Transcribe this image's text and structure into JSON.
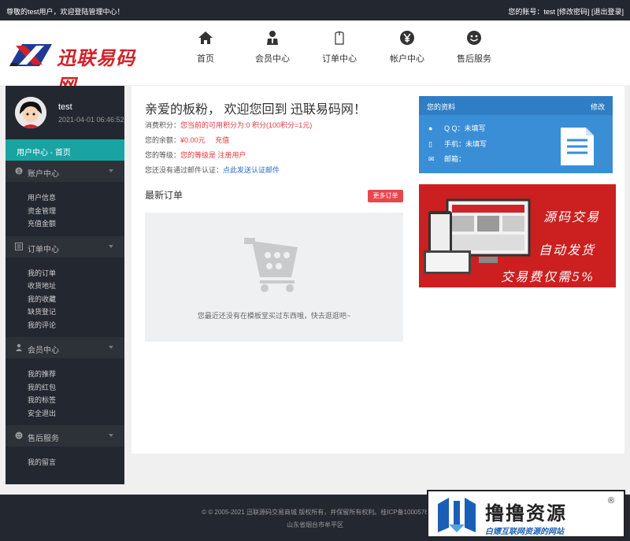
{
  "topbar": {
    "greeting": "尊敬的test用户，欢迎登陆管理中心！",
    "account": "您的账号：test",
    "change_pwd": "[修改密码]",
    "logout": "[退出登录]"
  },
  "brand": {
    "logo_text": "迅联易码网",
    "accent": "#d1222a"
  },
  "nav": [
    {
      "label": "首页",
      "icon": "home-icon"
    },
    {
      "label": "会员中心",
      "icon": "member-icon"
    },
    {
      "label": "订单中心",
      "icon": "order-icon"
    },
    {
      "label": "帐户中心",
      "icon": "yen-coin-icon"
    },
    {
      "label": "售后服务",
      "icon": "smile-icon"
    }
  ],
  "sidebar": {
    "username": "test",
    "login_time": "2021-04-01 06:46:52",
    "active": "用户中心 - 首页",
    "groups": [
      {
        "label": "账户中心",
        "icon": "dollar-circle-icon",
        "items": [
          "用户信息",
          "资金管理",
          "充值金额"
        ]
      },
      {
        "label": "订单中心",
        "icon": "list-icon",
        "items": [
          "我的订单",
          "收货地址",
          "我的收藏",
          "缺货登记",
          "我的评论"
        ]
      },
      {
        "label": "会员中心",
        "icon": "user-icon",
        "items": [
          "我的推荐",
          "我的红包",
          "我的标签",
          "安全退出"
        ]
      },
      {
        "label": "售后服务",
        "icon": "smile-icon",
        "items": [
          "我的留言"
        ]
      }
    ]
  },
  "main": {
    "welcome": "亲爱的板粉， 欢迎您回到 迅联易码网！",
    "points_label": "消费积分：",
    "points_value": "您当前的可用积分为:0 积分(100积分=1元)",
    "balance_label": "您的余额：",
    "balance_value": "¥0.00元",
    "recharge": "充值",
    "level_label": "您的等级：",
    "level_value": "您的等级是 注册用户",
    "email_label": "您还没有通过邮件认证：",
    "email_link": "点此发送认证邮件",
    "orders_title": "最新订单",
    "more_orders": "更多订单",
    "empty_text": "您最近还没有在模板堂买过东西哦，快去逛逛吧~"
  },
  "myinfo": {
    "title": "您的资料",
    "edit": "修改",
    "qq": "Q Q：未填写",
    "phone": "手机：未填写",
    "email": "邮箱："
  },
  "promo": {
    "line1": "源码交易",
    "line2": "自动发货",
    "line3": "交易费仅需5%"
  },
  "footer": {
    "line1": "© © 2005-2021 迅联源码交易商城 版权所有，并保留所有权利。桂ICP备1000576",
    "line2": "山东省烟台市牟平区"
  },
  "watermark": {
    "title": "撸撸资源",
    "sub": "白嫖互联网资源的网站",
    "reg": "®"
  },
  "colors": {
    "dark": "#232830",
    "teal": "#19a3a3",
    "blue": "#3a8ed6",
    "red": "#e4393c"
  }
}
